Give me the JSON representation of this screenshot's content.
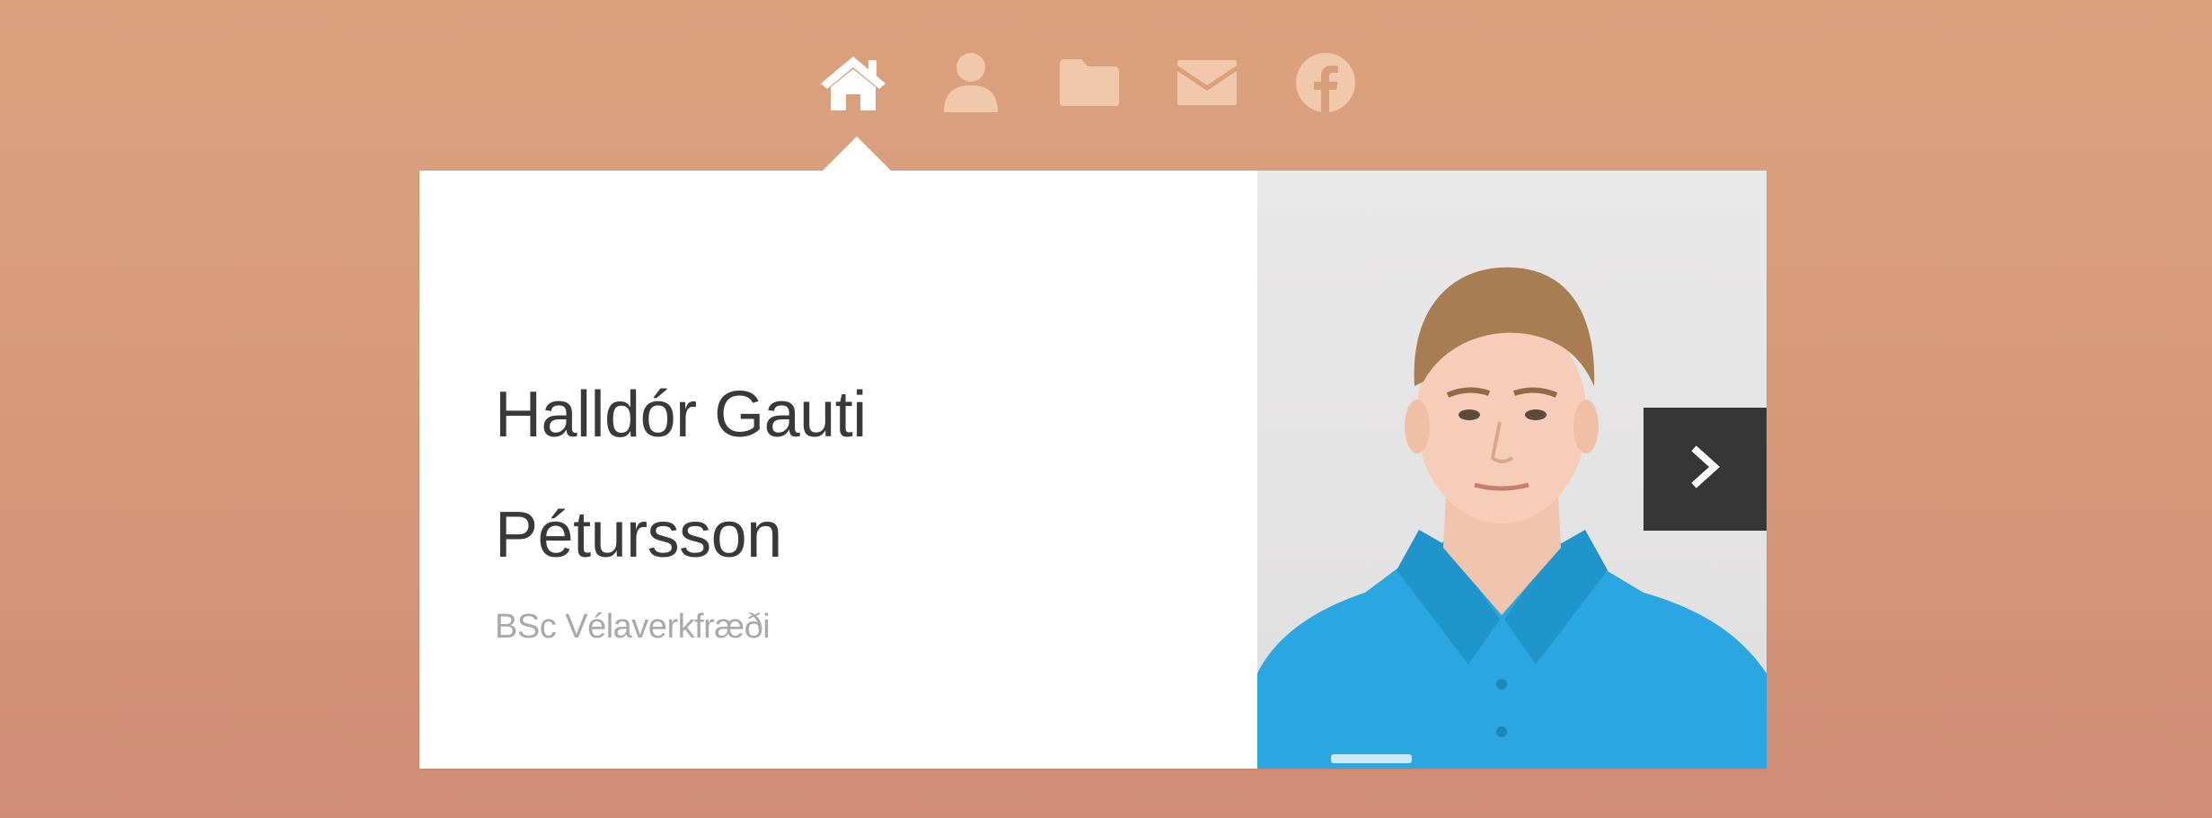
{
  "nav": {
    "items": [
      {
        "icon": "home-icon",
        "active": true
      },
      {
        "icon": "user-icon",
        "active": false
      },
      {
        "icon": "folder-icon",
        "active": false
      },
      {
        "icon": "mail-icon",
        "active": false
      },
      {
        "icon": "facebook-icon",
        "active": false
      }
    ]
  },
  "profile": {
    "name_line1": "Halldór Gauti",
    "name_line2": "Pétursson",
    "degree": "BSc Vélaverkfræði"
  },
  "colors": {
    "background_top": "#dba17d",
    "background_bottom": "#cf8d76",
    "card": "#ffffff",
    "name_text": "#393939",
    "degree_text": "#a9a9a9",
    "next_button": "#363636",
    "icon_active": "#ffffff",
    "icon_inactive": "#f0c8ac",
    "shirt": "#2aa7e0"
  }
}
